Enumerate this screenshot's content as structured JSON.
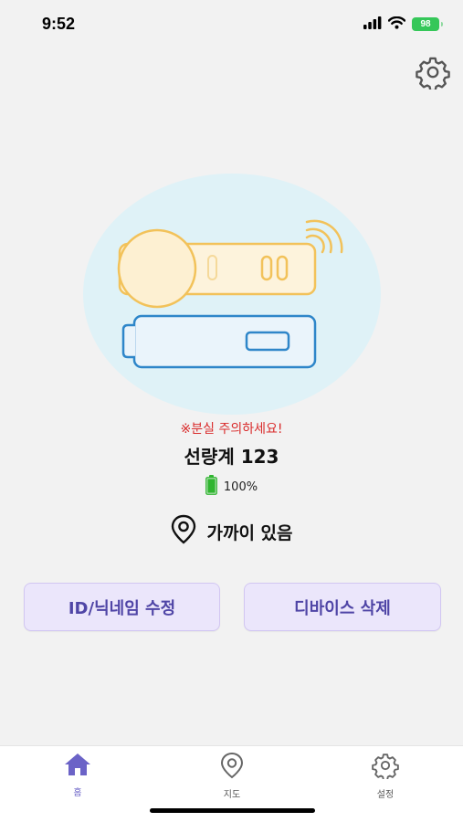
{
  "status_bar": {
    "time": "9:52",
    "battery_level": "98",
    "battery_color": "#35c759",
    "icons": [
      "signal-icon",
      "wifi-icon",
      "battery-icon"
    ]
  },
  "header": {
    "settings_icon": "gear-icon"
  },
  "device": {
    "warning": "※분실 주의하세요!",
    "name": "선량계 123",
    "battery_percent": "100%",
    "battery_fill": 1.0,
    "proximity": "가까이 있음"
  },
  "actions": {
    "edit_label": "ID/닉네임 수정",
    "delete_label": "디바이스 삭제"
  },
  "tabs": [
    {
      "label": "홈",
      "icon": "home-icon",
      "active": true
    },
    {
      "label": "지도",
      "icon": "map-pin-icon",
      "active": false
    },
    {
      "label": "설정",
      "icon": "gear-icon",
      "active": false
    }
  ],
  "colors": {
    "accent": "#6b63c7",
    "button_bg": "#ebe6fb",
    "warning": "#d92b2b",
    "device_yellow": "#f2c25a",
    "device_blue": "#2e86c9"
  }
}
